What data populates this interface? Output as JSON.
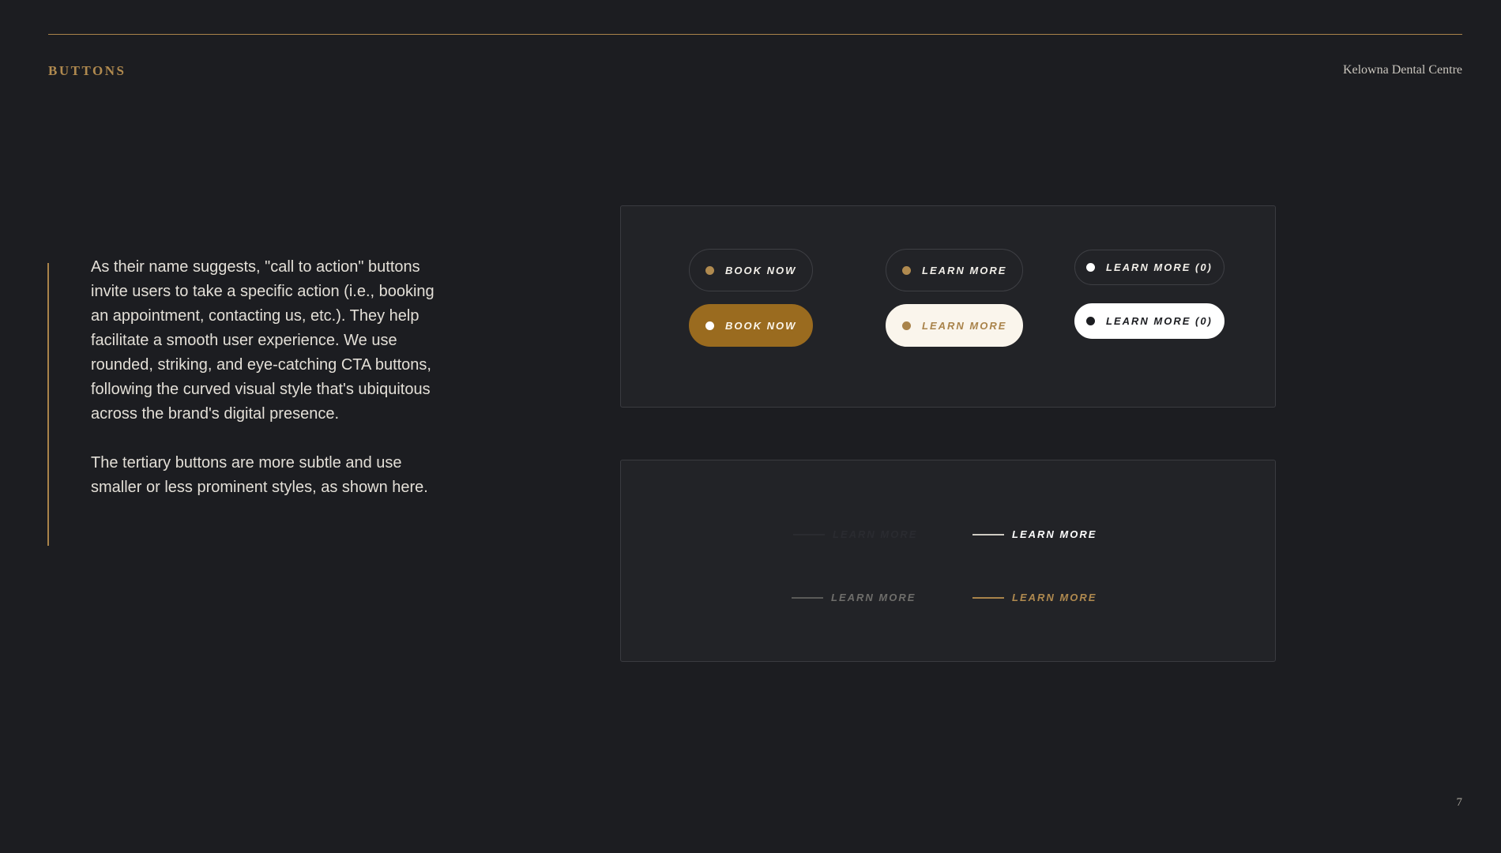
{
  "header": {
    "section_label": "BUTTONS",
    "brand_name": "Kelowna Dental Centre"
  },
  "intro": {
    "paragraphs": [
      "As their name suggests, \"call to action\" buttons invite users to take a specific action (i.e., booking an appointment, contacting us, etc.). They help facilitate a smooth user experience. We use rounded, striking, and eye-catching CTA buttons, following the curved visual style that's ubiquitous across the brand's digital presence.",
      "The tertiary buttons are more subtle and use smaller or less prominent styles, as shown here."
    ]
  },
  "primary_buttons": [
    {
      "label": "BOOK NOW",
      "style": "outline"
    },
    {
      "label": "LEARN MORE",
      "style": "outline"
    },
    {
      "label": "LEARN MORE (0)",
      "style": "outline-white"
    },
    {
      "label": "BOOK NOW",
      "style": "gold"
    },
    {
      "label": "LEARN MORE",
      "style": "cream"
    },
    {
      "label": "LEARN MORE (0)",
      "style": "white"
    }
  ],
  "tertiary_buttons": [
    {
      "label": "LEARN MORE",
      "style": "dark"
    },
    {
      "label": "LEARN MORE",
      "style": "white"
    },
    {
      "label": "LEARN MORE",
      "style": "grey"
    },
    {
      "label": "LEARN MORE",
      "style": "gold"
    }
  ],
  "colors": {
    "background": "#1c1d21",
    "panel": "#222327",
    "accent_gold": "#b08a4f",
    "button_gold": "#9a6b1f",
    "cream": "#faf5ec"
  },
  "footer": {
    "page_number": "7"
  }
}
